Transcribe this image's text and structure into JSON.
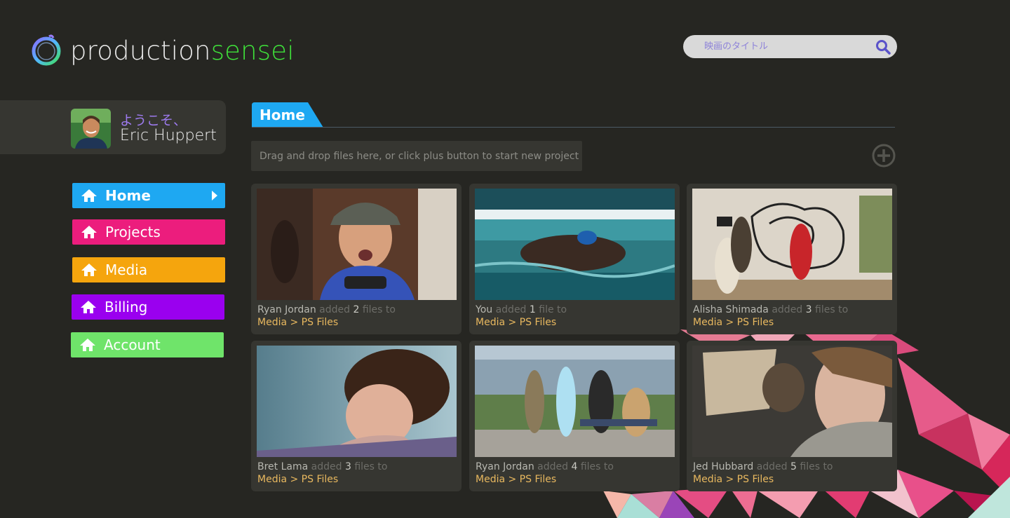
{
  "brand": {
    "name_part1": "production",
    "name_part2": "sensei"
  },
  "search": {
    "placeholder": "映画のタイトル"
  },
  "user": {
    "welcome": "ようこそ、",
    "name": "Eric Huppert"
  },
  "nav": [
    {
      "label": "Home",
      "color": "#1ea8f2",
      "active": true
    },
    {
      "label": "Projects",
      "color": "#ec1d7d"
    },
    {
      "label": "Media",
      "color": "#f5a50d"
    },
    {
      "label": "Billing",
      "color": "#9a00ef"
    },
    {
      "label": "Account",
      "color": "#6fe46a"
    }
  ],
  "main": {
    "tab": "Home",
    "dropzone": "Drag and drop files here, or click plus button to start new project"
  },
  "cards": [
    {
      "user": "Ryan Jordan",
      "added": "added",
      "count": "2",
      "unit": "files to",
      "path": "Media > PS Files"
    },
    {
      "user": "You",
      "added": "added",
      "count": "1",
      "unit": "file to",
      "path": "Media > PS Files"
    },
    {
      "user": "Alisha Shimada",
      "added": "added",
      "count": "3",
      "unit": "files to",
      "path": "Media > PS Files"
    },
    {
      "user": "Bret Lama",
      "added": "added",
      "count": "3",
      "unit": "files to",
      "path": "Media > PS Files"
    },
    {
      "user": "Ryan Jordan",
      "added": "added",
      "count": "4",
      "unit": "files to",
      "path": "Media > PS Files"
    },
    {
      "user": "Jed Hubbard",
      "added": "added",
      "count": "5",
      "unit": "files to",
      "path": "Media > PS Files"
    }
  ]
}
